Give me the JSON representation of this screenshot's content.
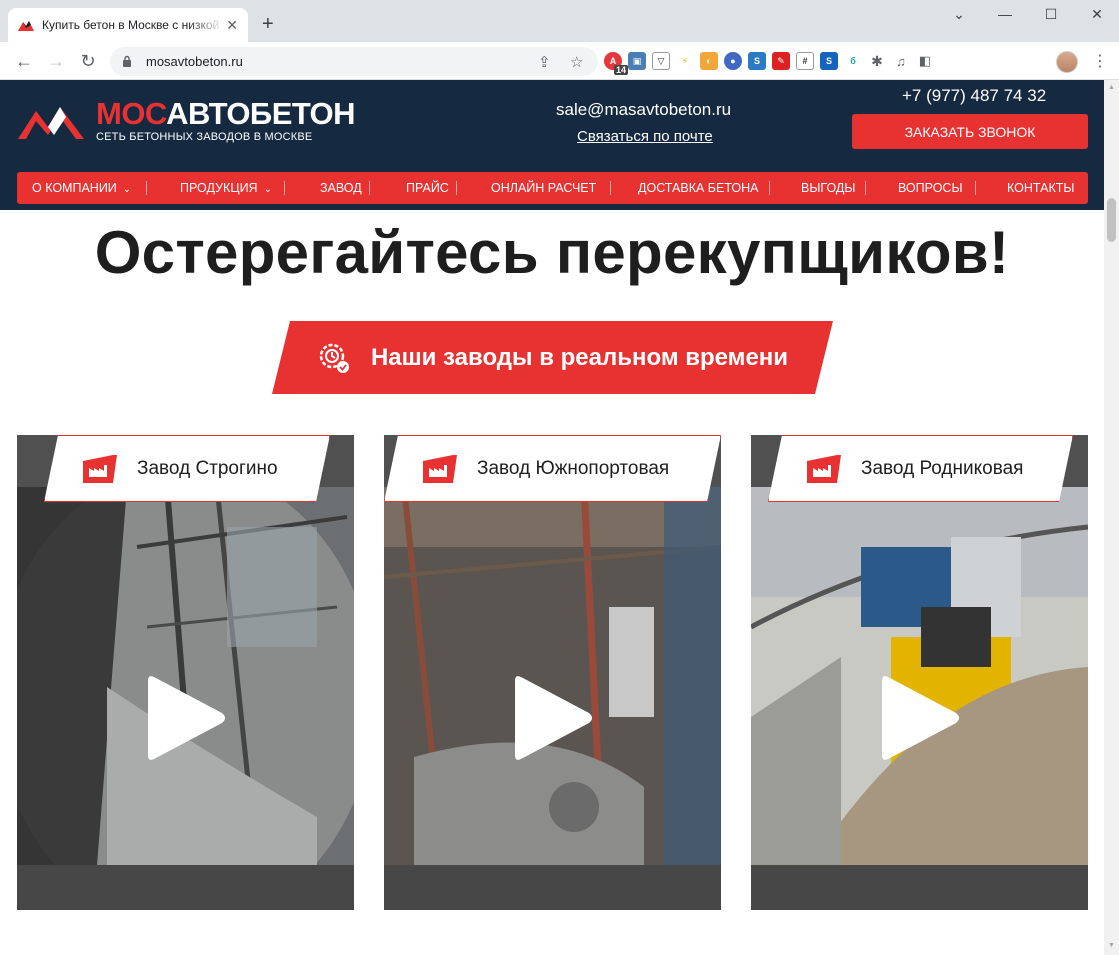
{
  "browser": {
    "tab_title": "Купить бетон в Москве с низкой ценой",
    "url": "mosavtobeton.ru",
    "ext_badge": "14"
  },
  "header": {
    "logo_title_red": "МОС",
    "logo_title_white": "АВТОБЕТОН",
    "logo_subtitle": "СЕТЬ БЕТОННЫХ ЗАВОДОВ В МОСКВЕ",
    "email": "sale@masavtobeton.ru",
    "email_link": "Связаться по почте",
    "phone": "+7 (977) 487 74 32",
    "call_button": "ЗАКАЗАТЬ ЗВОНОК"
  },
  "nav": {
    "items": [
      {
        "label": "О КОМПАНИИ",
        "has_dropdown": true
      },
      {
        "label": "ПРОДУКЦИЯ",
        "has_dropdown": true
      },
      {
        "label": "ЗАВОД"
      },
      {
        "label": "ПРАЙС"
      },
      {
        "label": "ОНЛАЙН РАСЧЕТ"
      },
      {
        "label": "ДОСТАВКА БЕТОНА"
      },
      {
        "label": "ВЫГОДЫ"
      },
      {
        "label": "ВОПРОСЫ"
      },
      {
        "label": "КОНТАКТЫ"
      }
    ]
  },
  "main": {
    "headline": "Остерегайтесь перекупщиков!",
    "realtime_button": "Наши заводы в реальном времени",
    "cameras": [
      {
        "name": "Завод Строгино"
      },
      {
        "name": "Завод Южнопортовая"
      },
      {
        "name": "Завод Родниковая"
      }
    ]
  },
  "colors": {
    "brand_red": "#e83232",
    "header_navy": "#152a40"
  }
}
